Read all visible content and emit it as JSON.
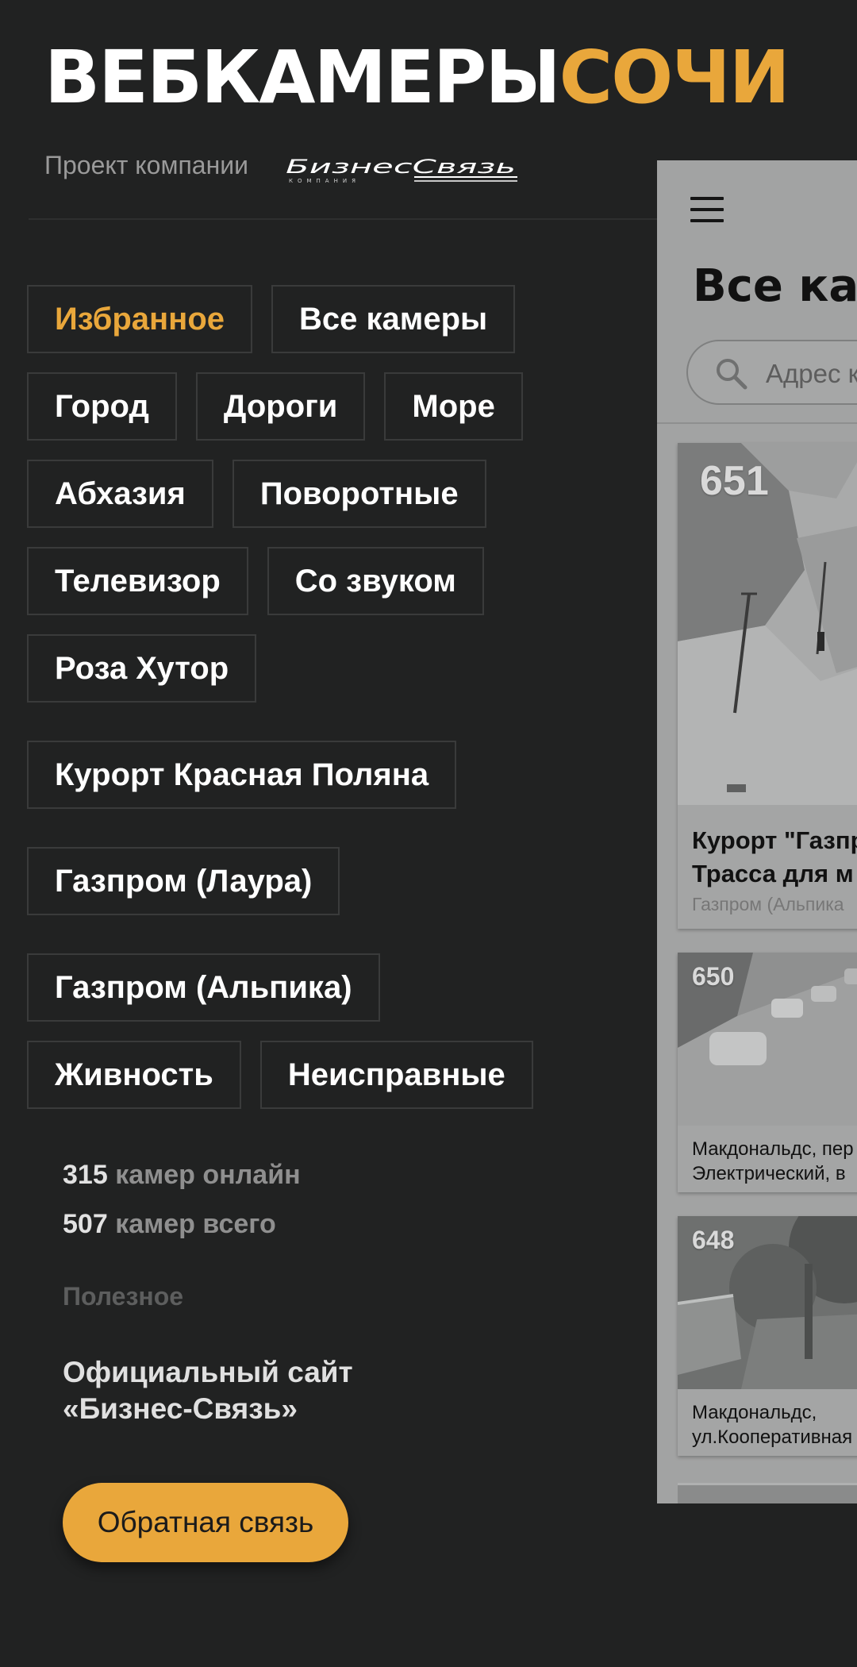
{
  "logo": {
    "part1": "ВЕБКАМЕРЫ",
    "part2": "СОЧИ"
  },
  "project_label": "Проект компании",
  "company_logo": {
    "name": "БизнесСвязь",
    "subtitle": "КОМПАНИЯ"
  },
  "categories": [
    {
      "label": "Избранное",
      "active": true
    },
    {
      "label": "Все камеры",
      "active": false
    },
    {
      "label": "Город",
      "active": false
    },
    {
      "label": "Дороги",
      "active": false
    },
    {
      "label": "Море",
      "active": false
    },
    {
      "label": "Абхазия",
      "active": false
    },
    {
      "label": "Поворотные",
      "active": false
    },
    {
      "label": "Телевизор",
      "active": false
    },
    {
      "label": "Со звуком",
      "active": false
    },
    {
      "label": "Роза Хутор",
      "active": false
    },
    {
      "label": "Курорт Красная Поляна",
      "active": false
    },
    {
      "label": "Газпром (Лаура)",
      "active": false
    },
    {
      "label": "Газпром (Альпика)",
      "active": false
    },
    {
      "label": "Живность",
      "active": false
    },
    {
      "label": "Неисправные",
      "active": false
    }
  ],
  "stats": {
    "online_count": "315",
    "online_label": "камер онлайн",
    "total_count": "507",
    "total_label": "камер всего"
  },
  "useful_heading": "Полезное",
  "official_link": {
    "line1": "Официальный сайт",
    "line2": "«Бизнес-Связь»"
  },
  "feedback_button": "Обратная связь",
  "main": {
    "menu_icon": "hamburger-menu-icon",
    "title": "Все кам",
    "search_placeholder": "Адрес к",
    "cards": [
      {
        "number": "651",
        "title_line1": "Курорт \"Газпр",
        "title_line2": "Трасса для м",
        "subtitle": "Газпром (Альпика"
      },
      {
        "number": "650",
        "title_line1": "Макдональдс, пер",
        "title_line2": "Электрический, в"
      },
      {
        "number": "648",
        "title_line1": "Макдональдс,",
        "title_line2": "ул.Кооперативная"
      }
    ]
  },
  "colors": {
    "background": "#212222",
    "accent": "#e9a73b",
    "chip_border": "#3a3b3b"
  }
}
